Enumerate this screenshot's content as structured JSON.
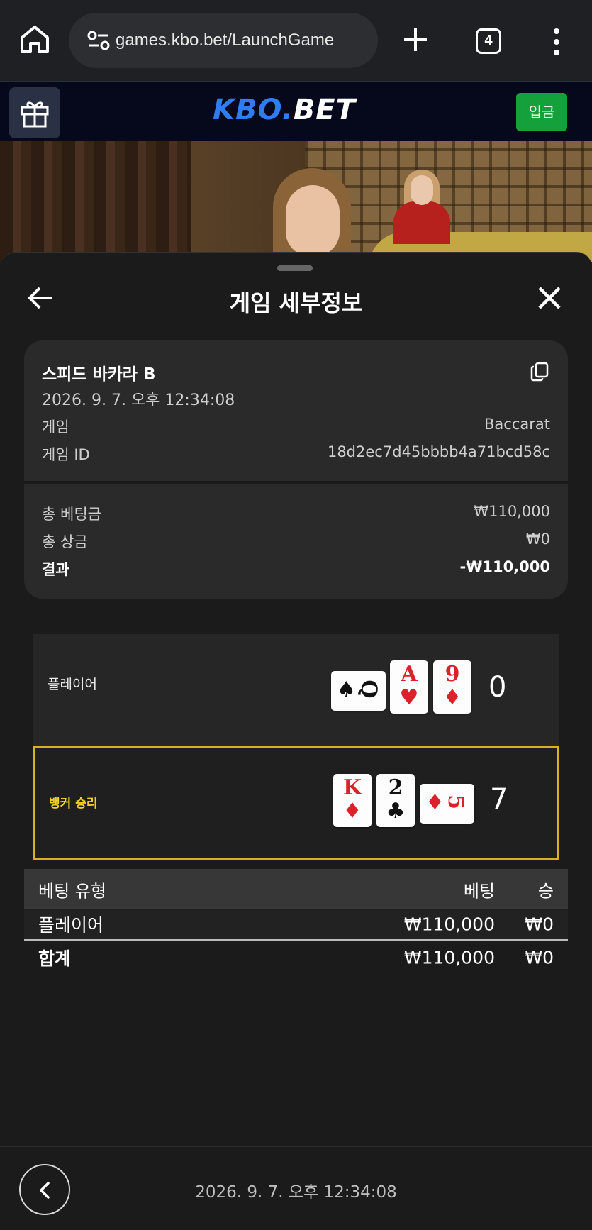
{
  "browser": {
    "url": "games.kbo.bet/LaunchGame",
    "tab_count": "4"
  },
  "site": {
    "logo_part1": "KBO.",
    "logo_part2": "BET",
    "deposit_label": "입금"
  },
  "sheet": {
    "title": "게임 세부정보"
  },
  "summary": {
    "game_name": "스피드 바카라 B",
    "timestamp": "2026. 9. 7. 오후 12:34:08",
    "game_label": "게임",
    "game_value": "Baccarat",
    "game_id_label": "게임 ID",
    "game_id_value": "18d2ec7d45bbbb4a71bcd58c",
    "total_bet_label": "총 베팅금",
    "total_bet_value": "₩110,000",
    "total_win_label": "총 상금",
    "total_win_value": "₩0",
    "result_label": "결과",
    "result_value": "-₩110,000"
  },
  "hands": {
    "player": {
      "label": "플레이어",
      "score": "0",
      "cards": [
        {
          "rank": "Q",
          "suit": "♠",
          "color": "black",
          "orientation": "sideways"
        },
        {
          "rank": "A",
          "suit": "♥",
          "color": "red",
          "orientation": "upright"
        },
        {
          "rank": "9",
          "suit": "♦",
          "color": "red",
          "orientation": "upright"
        }
      ]
    },
    "banker": {
      "label": "뱅커 승리",
      "score": "7",
      "highlight_color": "#d6b21f",
      "cards": [
        {
          "rank": "K",
          "suit": "♦",
          "color": "red",
          "orientation": "upright"
        },
        {
          "rank": "2",
          "suit": "♣",
          "color": "black",
          "orientation": "upright"
        },
        {
          "rank": "5",
          "suit": "♦",
          "color": "red",
          "orientation": "sideways"
        }
      ]
    }
  },
  "bets": {
    "headers": {
      "type": "베팅 유형",
      "bet": "베팅",
      "win": "승"
    },
    "rows": [
      {
        "type": "플레이어",
        "bet": "₩110,000",
        "win": "₩0"
      }
    ],
    "total": {
      "type": "합계",
      "bet": "₩110,000",
      "win": "₩0"
    }
  },
  "footer": {
    "timestamp": "2026. 9. 7. 오후 12:34:08"
  },
  "colors": {
    "accent_blue": "#2f7df6",
    "deposit_green": "#14a03b",
    "winner_gold": "#d6b21f"
  }
}
